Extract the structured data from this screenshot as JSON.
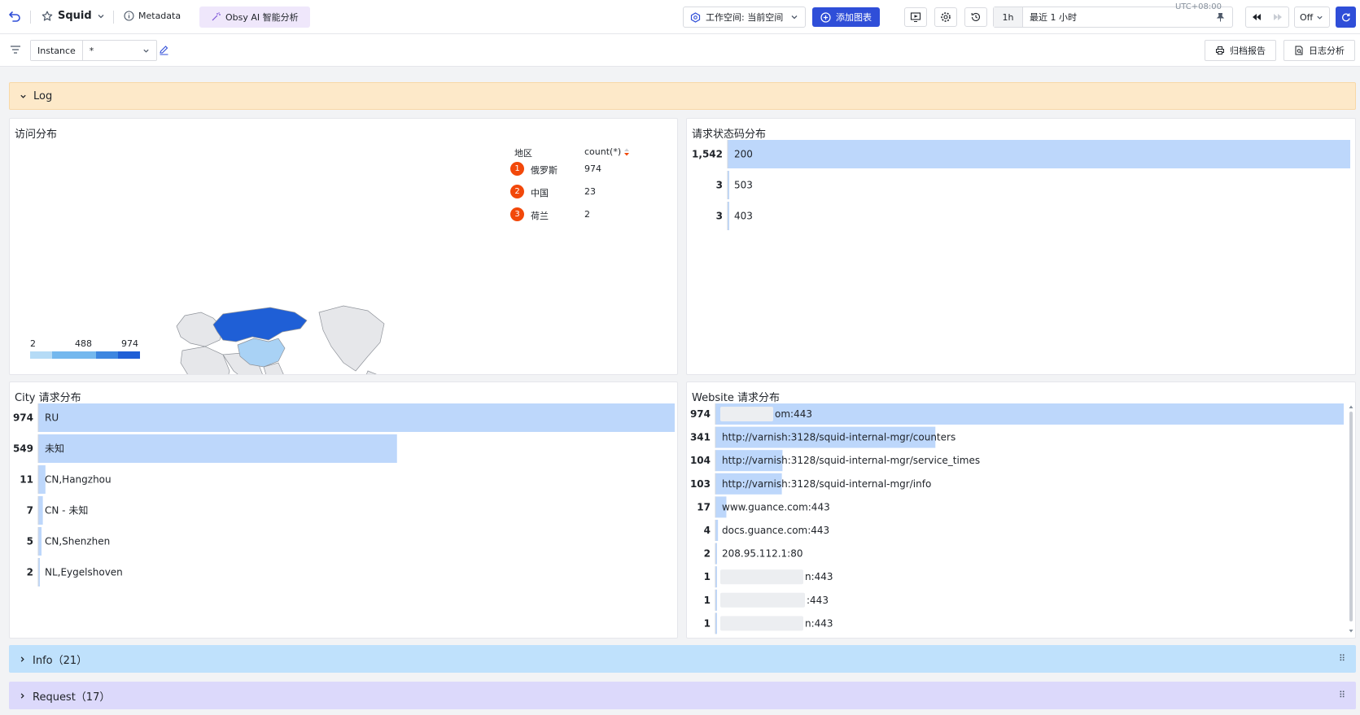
{
  "topbar": {
    "dashboard_name": "Squid",
    "metadata_label": "Metadata",
    "ai_label": "Obsy AI 智能分析",
    "workspace_label": "工作空间: 当前空间",
    "add_chart_label": "添加图表",
    "range_short": "1h",
    "range_label": "最近 1 小时",
    "refresh_label": "Off",
    "timezone": "UTC+08:00"
  },
  "filterbar": {
    "var_label": "Instance",
    "var_value": "*",
    "archive_label": "归档报告",
    "log_analysis_label": "日志分析"
  },
  "groups": {
    "log": "Log",
    "info": "Info（21）",
    "request": "Request（17）"
  },
  "map_panel": {
    "title": "访问分布",
    "table_headers": [
      "地区",
      "count(*)"
    ],
    "rows": [
      {
        "rank": "1",
        "region": "俄罗斯",
        "count": "974"
      },
      {
        "rank": "2",
        "region": "中国",
        "count": "23"
      },
      {
        "rank": "3",
        "region": "荷兰",
        "count": "2"
      }
    ],
    "legend": {
      "min": "2",
      "mid": "488",
      "max": "974"
    },
    "colors": {
      "high": "#1f5fd6",
      "low": "#a9d2f5",
      "base": "#e6e7ea"
    }
  },
  "chart_data": [
    {
      "type": "bar",
      "title": "请求状态码分布",
      "categories": [
        "200",
        "503",
        "403"
      ],
      "values": [
        1542,
        3,
        3
      ],
      "value_labels": [
        "1,542",
        "3",
        "3"
      ]
    },
    {
      "type": "bar",
      "title": "City 请求分布",
      "categories": [
        "RU",
        "未知",
        "CN,Hangzhou",
        "CN - 未知",
        "CN,Shenzhen",
        "NL,Eygelshoven"
      ],
      "values": [
        974,
        549,
        11,
        7,
        5,
        2
      ]
    },
    {
      "type": "bar",
      "title": "Website 请求分布",
      "categories": [
        "om:443",
        "http://varnish:3128/squid-internal-mgr/counters",
        "http://varnish:3128/squid-internal-mgr/service_times",
        "http://varnish:3128/squid-internal-mgr/info",
        "www.guance.com:443",
        "docs.guance.com:443",
        "208.95.112.1:80",
        "n:443",
        ":443",
        "n:443"
      ],
      "values": [
        974,
        341,
        104,
        103,
        17,
        4,
        2,
        1,
        1,
        1
      ]
    }
  ]
}
